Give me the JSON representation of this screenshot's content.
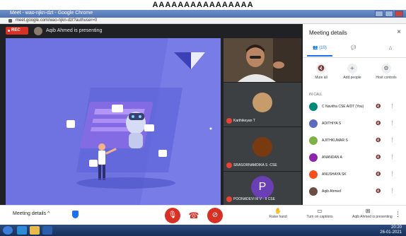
{
  "banner": {
    "text": "AAAAAAAAAAAAAAAA"
  },
  "browser": {
    "title": "Meet - wao-njkn-dzt - Google Chrome",
    "url": "meet.google.com/wao-njkn-dzt?authuser=0"
  },
  "meet": {
    "recording_label": "REC",
    "presenting_text": "Aqib Ahmed is presenting",
    "tiles": [
      {
        "name": ""
      },
      {
        "name": "Karthikeyan T"
      },
      {
        "name": "SRASORNAMDIKA S -CSE"
      },
      {
        "name": "POONADEVI M V - II CSE",
        "initial": "P"
      }
    ]
  },
  "panel": {
    "title": "Meeting details",
    "close_icon": "×",
    "tabs": [
      {
        "icon": "people-icon",
        "label": "(10)"
      },
      {
        "icon": "chat-icon",
        "label": ""
      },
      {
        "icon": "activities-icon",
        "label": ""
      }
    ],
    "actions": [
      {
        "label": "Mute all",
        "glyph": "🔇"
      },
      {
        "label": "Add people",
        "glyph": "+"
      },
      {
        "label": "Host controls",
        "glyph": "⚙"
      }
    ],
    "in_call_label": "IN CALL",
    "participants": [
      {
        "name": "C Navitha CSE AIDT (You)",
        "color": "#00897b"
      },
      {
        "name": "ADITHIYA S",
        "color": "#5c6bc0"
      },
      {
        "name": "AJITHKUMAR S",
        "color": "#7cb342"
      },
      {
        "name": "ANANDAN A",
        "color": "#8e24aa"
      },
      {
        "name": "ANUSHAYA SK",
        "color": "#f4511e"
      },
      {
        "name": "Aqib Ahmed",
        "color": "#6d4c41"
      }
    ]
  },
  "bottombar": {
    "meeting_details": "Meeting details ^",
    "raise_hand": "Raise hand",
    "captions": "Turn on captions",
    "present_now": "Aqib Ahmed is presenting",
    "more": "⋮"
  },
  "taskbar": {
    "time": "20:20",
    "date": "26-01-2021"
  }
}
